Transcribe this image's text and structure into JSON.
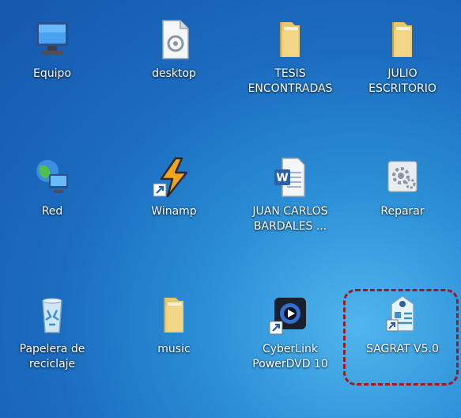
{
  "desktop": {
    "icons": [
      {
        "label": "Equipo",
        "icon": "computer-icon"
      },
      {
        "label": "desktop",
        "icon": "document-file-icon"
      },
      {
        "label": "TESIS\nENCONTRADAS",
        "icon": "folder-icon"
      },
      {
        "label": "JULIO\nESCRITORIO",
        "icon": "folder-icon"
      },
      {
        "label": "Red",
        "icon": "network-icon"
      },
      {
        "label": "Winamp",
        "icon": "winamp-icon"
      },
      {
        "label": "JUAN CARLOS\nBARDALES ...",
        "icon": "word-document-icon"
      },
      {
        "label": "Reparar",
        "icon": "repair-gear-icon"
      },
      {
        "label": "Papelera de\nreciclaje",
        "icon": "recycle-bin-icon"
      },
      {
        "label": "music",
        "icon": "folder-icon"
      },
      {
        "label": "CyberLink\nPowerDVD 10",
        "icon": "powerdvd-icon"
      },
      {
        "label": "SAGRAT V5.0",
        "icon": "sagrat-app-icon"
      }
    ],
    "highlight_color": "#a31818"
  }
}
